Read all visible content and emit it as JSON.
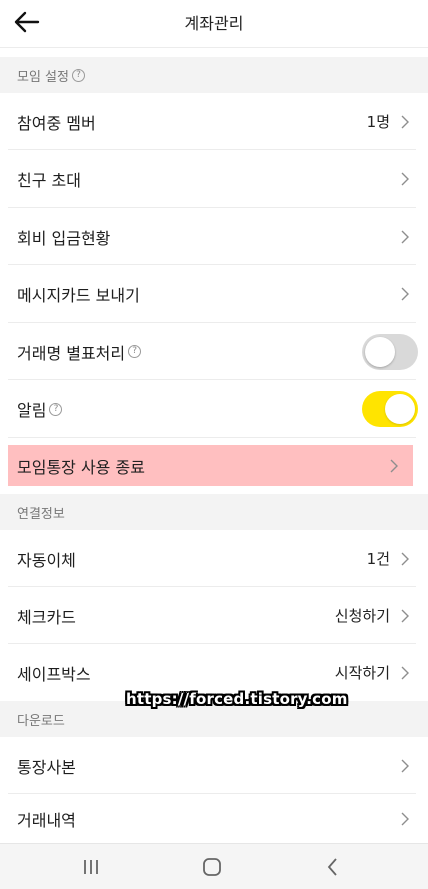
{
  "header": {
    "title": "계좌관리"
  },
  "sections": {
    "group_settings": "모임 설정",
    "connection_info": "연결정보",
    "download": "다운로드"
  },
  "help_glyph": "?",
  "rows": {
    "members": {
      "label": "참여중 멤버",
      "value": "1명"
    },
    "invite": {
      "label": "친구 초대"
    },
    "dues": {
      "label": "회비 입금현황"
    },
    "message_card": {
      "label": "메시지카드 보내기"
    },
    "mask_names": {
      "label": "거래명 별표처리",
      "toggle": "off"
    },
    "alerts": {
      "label": "알림",
      "toggle": "on"
    },
    "end_account": {
      "label": "모임통장 사용 종료"
    },
    "auto_transfer": {
      "label": "자동이체",
      "value": "1건"
    },
    "check_card": {
      "label": "체크카드",
      "value": "신청하기"
    },
    "safebox": {
      "label": "세이프박스",
      "value": "시작하기"
    },
    "bankbook_copy": {
      "label": "통장사본"
    },
    "transactions": {
      "label": "거래내역"
    }
  },
  "colors": {
    "toggle_on": "#ffe400",
    "toggle_off": "#d9d9d9",
    "highlight": "#ffbfc0",
    "section_bg": "#f3f3f3"
  },
  "icons": [
    "back-arrow-icon",
    "help-icon",
    "chevron-right-icon",
    "recent-apps-icon",
    "home-icon",
    "nav-back-icon"
  ],
  "watermark": "https://forced.tistory.com"
}
